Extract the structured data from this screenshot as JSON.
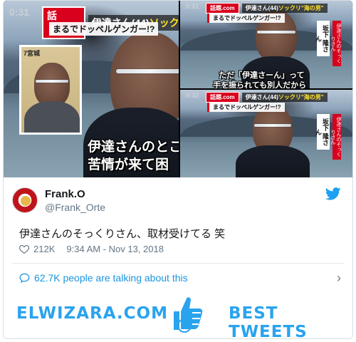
{
  "photos": {
    "main": {
      "clock": "0:31",
      "brand": "話題.com",
      "headline_prefix": "伊達さん(44)",
      "headline_hl": "ソックリ\"海",
      "sub": "まるでドッペルゲンガー!?",
      "inset_label": "7宮城",
      "caption_line1": "伊達さんのとこ",
      "caption_line2": "苦情が来て困"
    },
    "top_right": {
      "clock": "0:31",
      "brand": "話題.com",
      "headline_prefix": "伊達さん(44)",
      "headline_hl": "ソックリ\"海の男\"",
      "sub": "まるでドッペルゲンガー!?",
      "name": "坂下 隆さん",
      "red_bar": "伊達さんのそっくりさん",
      "caption_line1": "ただ「伊達さーん」って",
      "caption_line2": "手を振られても別人だから"
    },
    "bottom_right": {
      "clock": "0:32",
      "brand": "話題.com",
      "headline_prefix": "伊達さん(44)",
      "headline_hl": "ソックリ\"海の男\"",
      "sub": "まるでドッペルゲンガー!?",
      "name": "坂下 隆さん",
      "red_bar": "伊達さんのそっくりさん"
    }
  },
  "tweet": {
    "display_name": "Frank.O",
    "handle": "@Frank_Orte",
    "text": "伊達さんのそっくりさん、取材受けてる 笑",
    "likes": "212K",
    "timestamp": "9:34 AM - Nov 13, 2018",
    "talking": "62.7K people are talking about this"
  },
  "banner": {
    "site": "ELWIZARA.COM",
    "tagline": "BEST TWEETS"
  },
  "colors": {
    "twitter_blue": "#1b95e0",
    "brand_blue": "#2aa3ee",
    "ticker_red": "#d8001c"
  }
}
